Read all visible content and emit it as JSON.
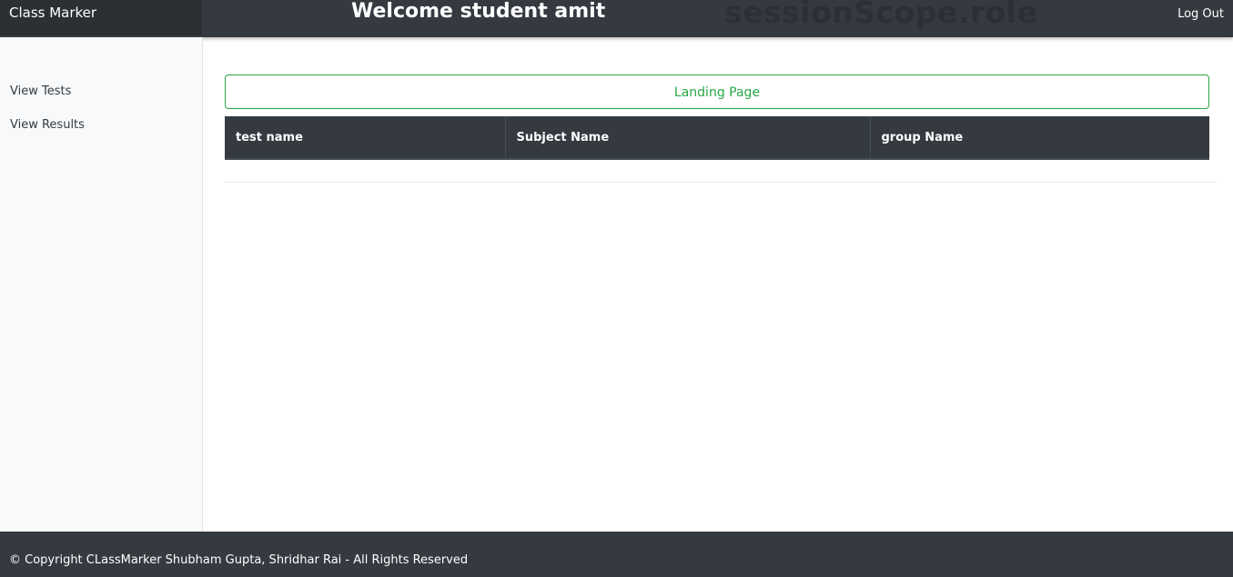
{
  "navbar": {
    "brand": "Class Marker",
    "welcome": "Welcome student amit",
    "role_placeholder": "sessionScope.role",
    "logout": "Log Out"
  },
  "sidebar": {
    "items": [
      {
        "label": "View Tests"
      },
      {
        "label": "View Results"
      }
    ]
  },
  "main": {
    "landing_button": "Landing Page",
    "table": {
      "columns": [
        "test name",
        "Subject Name",
        "group Name"
      ],
      "rows": []
    }
  },
  "footer": {
    "copyright": "© Copyright CLassMarker Shubham Gupta, Shridhar Rai - All Rights Reserved"
  },
  "colors": {
    "navbar_bg": "#343a40",
    "accent_success": "#28a745",
    "sidebar_bg": "#f8f9fa"
  }
}
